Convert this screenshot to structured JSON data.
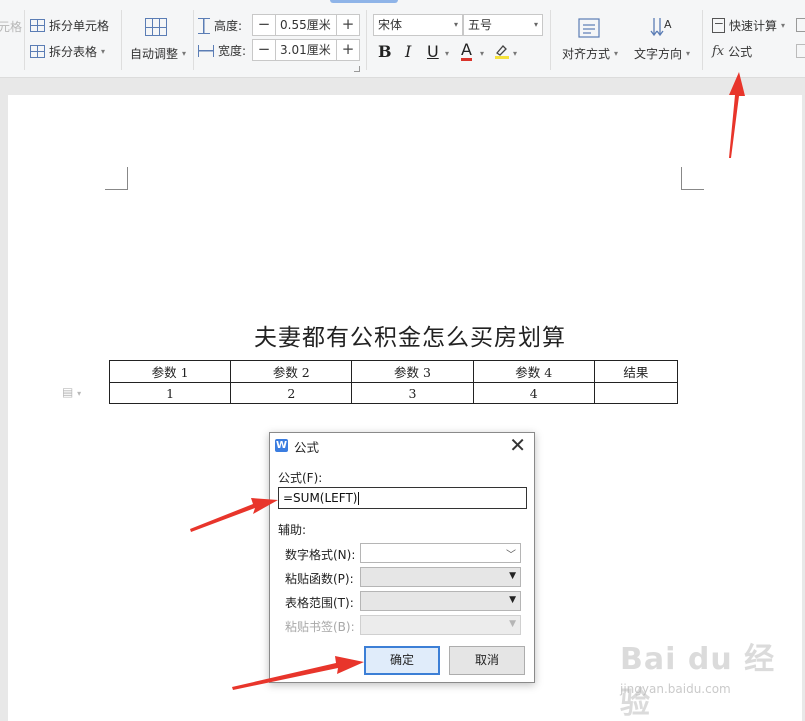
{
  "ribbon": {
    "merge_cells_partial": "元格",
    "split_cells": "拆分单元格",
    "split_table": "拆分表格",
    "auto_adjust": "自动调整",
    "height_label": "高度:",
    "height_value": "0.55厘米",
    "width_label": "宽度:",
    "width_value": "3.01厘米",
    "minus": "−",
    "plus": "+",
    "font_name": "宋体",
    "font_size": "五号",
    "bold": "B",
    "italic": "I",
    "underline": "U",
    "font_color": "A",
    "align": "对齐方式",
    "text_direction": "文字方向",
    "quick_calc": "快速计算",
    "formula_glyph": "fx",
    "formula": "公式",
    "font_color_hex": "#d9342b",
    "highlight_hex": "#f5e13a"
  },
  "document": {
    "title": "夫妻都有公积金怎么买房划算",
    "table": {
      "headers": [
        "参数 1",
        "参数 2",
        "参数 3",
        "参数 4",
        "结果"
      ],
      "rows": [
        [
          "1",
          "2",
          "3",
          "4",
          ""
        ]
      ]
    }
  },
  "dialog": {
    "logo": "W",
    "title": "公式",
    "close": "✕",
    "formula_label": "公式(F):",
    "formula_value": "=SUM(LEFT)",
    "assist_label": "辅助:",
    "number_format_label": "数字格式(N):",
    "paste_function_label": "粘贴函数(P):",
    "table_range_label": "表格范围(T):",
    "paste_bookmark_label": "粘贴书签(B):",
    "ok": "确定",
    "cancel": "取消",
    "accent_hex": "#3c7fd6"
  },
  "watermark": {
    "logo": "Bai du 经验",
    "url": "jingyan.baidu.com"
  },
  "annotation_color": "#e8352b"
}
